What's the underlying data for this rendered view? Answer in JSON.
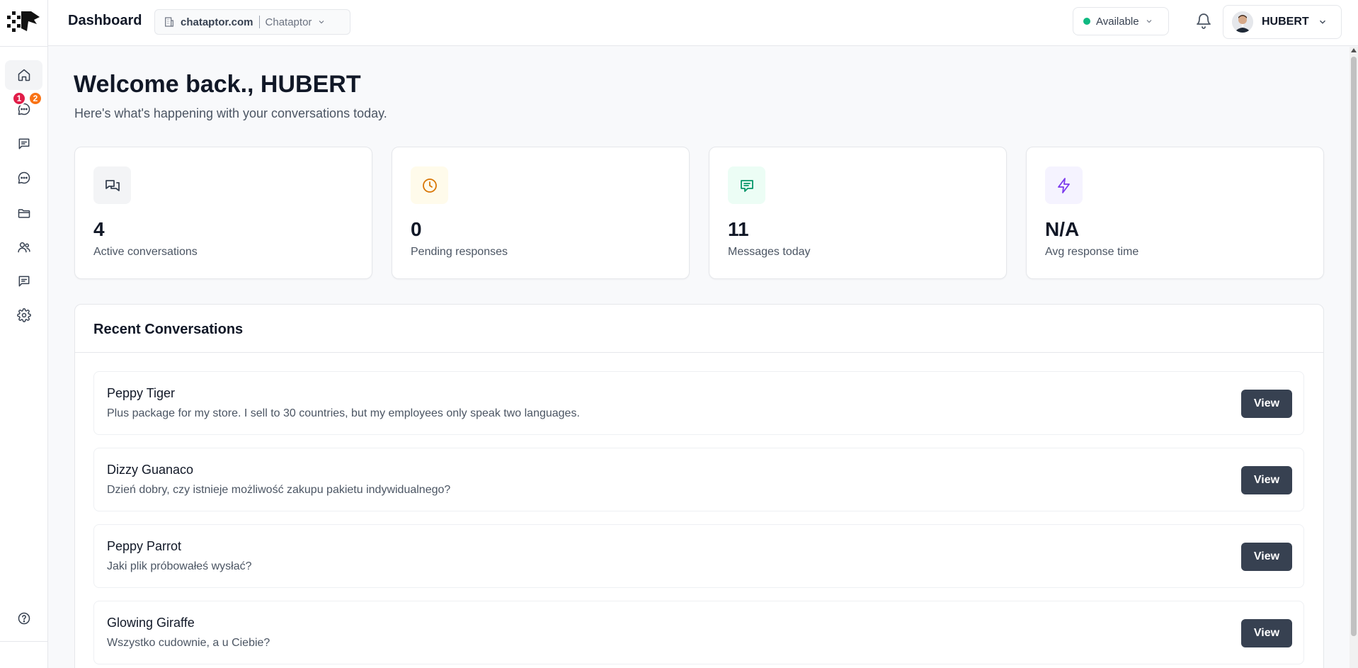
{
  "topbar": {
    "title": "Dashboard",
    "workspace_domain": "chataptor.com",
    "workspace_org": "Chataptor",
    "status": "Available",
    "status_color": "#10b981",
    "user_name": "HUBERT"
  },
  "sidebar": {
    "items": [
      {
        "name": "home",
        "icon": "home-icon"
      },
      {
        "name": "inbox",
        "icon": "chat-dots-icon",
        "badge1": "1",
        "badge2": "2"
      },
      {
        "name": "messages",
        "icon": "message-square-icon"
      },
      {
        "name": "chats",
        "icon": "chat-circle-icon"
      },
      {
        "name": "files",
        "icon": "folder-icon"
      },
      {
        "name": "team",
        "icon": "users-icon"
      },
      {
        "name": "feedback",
        "icon": "message-square-icon"
      },
      {
        "name": "settings",
        "icon": "gear-icon"
      }
    ],
    "help_icon": "help-icon"
  },
  "welcome": {
    "title": "Welcome back., HUBERT",
    "subtitle": "Here's what's happening with your conversations today."
  },
  "stats": [
    {
      "value": "4",
      "label": "Active conversations",
      "icon": "chats-icon",
      "color": "#374151",
      "bg": "#f3f4f6"
    },
    {
      "value": "0",
      "label": "Pending responses",
      "icon": "clock-icon",
      "color": "#d97706",
      "bg": "#fffbeb"
    },
    {
      "value": "11",
      "label": "Messages today",
      "icon": "message-icon",
      "color": "#059669",
      "bg": "#ecfdf5"
    },
    {
      "value": "N/A",
      "label": "Avg response time",
      "icon": "lightning-icon",
      "color": "#7c3aed",
      "bg": "#f5f3ff"
    }
  ],
  "recent": {
    "title": "Recent Conversations",
    "view_label": "View",
    "items": [
      {
        "name": "Peppy Tiger",
        "message": "Plus package for my store. I sell to 30 countries, but my employees only speak two languages."
      },
      {
        "name": "Dizzy Guanaco",
        "message": "Dzień dobry, czy istnieje możliwość zakupu pakietu indywidualnego?"
      },
      {
        "name": "Peppy Parrot",
        "message": "Jaki plik próbowałeś wysłać?"
      },
      {
        "name": "Glowing Giraffe",
        "message": "Wszystko cudownie, a u Ciebie?"
      }
    ]
  },
  "colors": {
    "badge_red": "#e11d48",
    "badge_orange": "#f97316",
    "button_dark": "#374151"
  }
}
